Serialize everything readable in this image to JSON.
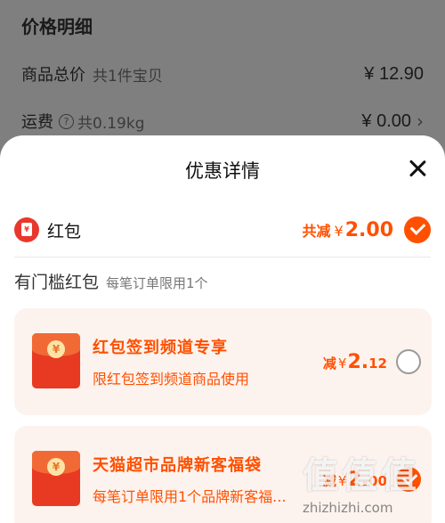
{
  "background": {
    "title": "价格明细",
    "rows": [
      {
        "label": "商品总价",
        "sub": "共1件宝贝",
        "value": "¥ 12.90"
      },
      {
        "label": "运费",
        "sub": "共0.19kg",
        "value": "¥ 0.00",
        "chevron": "›"
      }
    ]
  },
  "sheet": {
    "title": "优惠详情",
    "close_icon": "close-icon",
    "red_packet": {
      "label": "红包",
      "total_prefix": "共减",
      "currency": "¥",
      "total_amount": "2.00",
      "icon_glyph": "¥"
    },
    "section": {
      "title": "有门槛红包",
      "note": "每笔订单限用1个"
    },
    "coupons": [
      {
        "title": "红包签到频道专享",
        "desc": "限红包签到频道商品使用",
        "prefix": "减",
        "currency": "¥",
        "amount_int": "2.",
        "amount_dec": "12",
        "selected": false,
        "coin": "¥"
      },
      {
        "title": "天猫超市品牌新客福袋",
        "desc": "每笔订单限用1个品牌新客福...",
        "prefix": "减",
        "currency": "¥",
        "amount_int": "2.",
        "amount_dec": "00",
        "selected": true,
        "coin": "¥"
      }
    ]
  },
  "watermark": {
    "big": "值值值",
    "small": "zhizhizhi.com"
  },
  "colors": {
    "accent": "#ff5000",
    "card_bg": "#fdf3ee",
    "dim": "#7f7f7f"
  }
}
